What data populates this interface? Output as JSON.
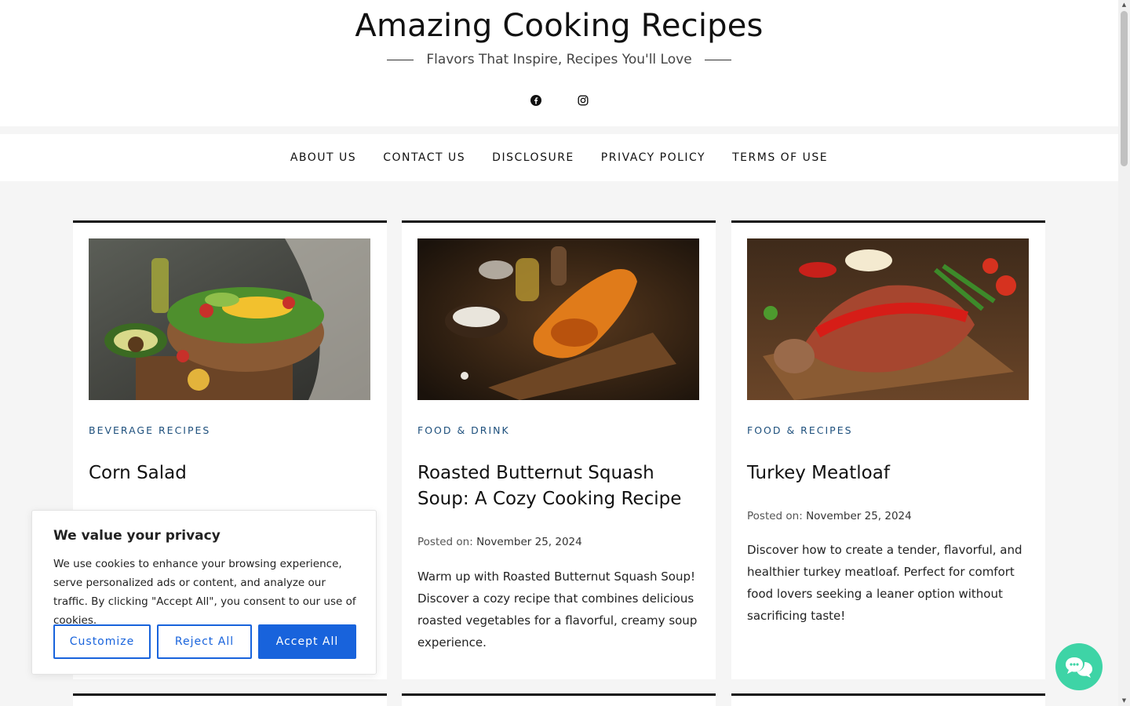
{
  "header": {
    "title": "Amazing Cooking Recipes",
    "tagline": "Flavors That Inspire, Recipes You'll Love"
  },
  "social": [
    {
      "icon": "facebook-icon"
    },
    {
      "icon": "instagram-icon"
    }
  ],
  "nav": [
    "ABOUT US",
    "CONTACT US",
    "DISCLOSURE",
    "PRIVACY POLICY",
    "TERMS OF USE"
  ],
  "posts": [
    {
      "category": "BEVERAGE RECIPES",
      "title": "Corn Salad",
      "image": "corn-salad-image"
    },
    {
      "category": "FOOD & DRINK",
      "title": "Roasted Butternut Squash Soup: A Cozy Cooking Recipe",
      "date_label": "Posted on:",
      "date": "November 25, 2024",
      "excerpt": "Warm up with Roasted Butternut Squash Soup! Discover a cozy recipe that combines delicious roasted vegetables for a flavorful, creamy soup experience.",
      "image": "butternut-squash-image"
    },
    {
      "category": "FOOD & RECIPES",
      "title": "Turkey Meatloaf",
      "date_label": "Posted on:",
      "date": "November 25, 2024",
      "excerpt": "Discover how to create a tender, flavorful, and healthier turkey meatloaf. Perfect for comfort food lovers seeking a leaner option without sacrificing taste!",
      "image": "turkey-meatloaf-image"
    }
  ],
  "cookie": {
    "title": "We value your privacy",
    "text": "We use cookies to enhance your browsing experience, serve personalized ads or content, and analyze our traffic. By clicking \"Accept All\", you consent to our use of cookies.",
    "customize": "Customize",
    "reject": "Reject All",
    "accept": "Accept All"
  },
  "colors": {
    "accent": "#1863dc",
    "category": "#1d4f7c",
    "chat": "#3ed4a6"
  }
}
